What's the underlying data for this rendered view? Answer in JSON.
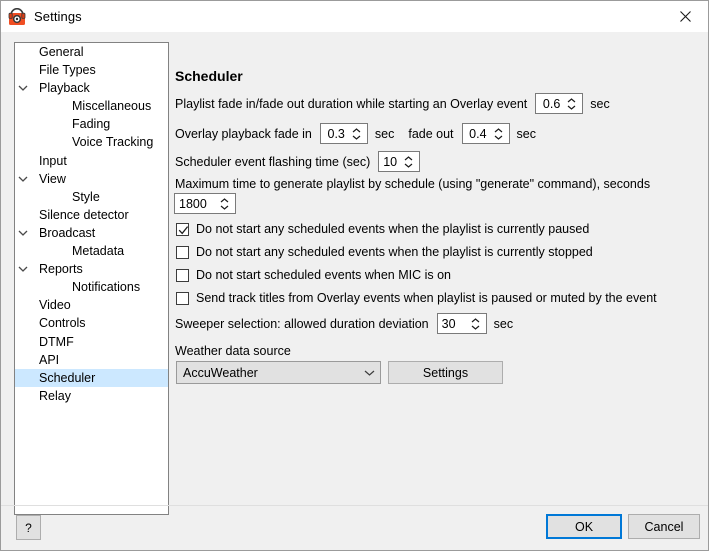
{
  "window": {
    "title": "Settings",
    "icon": "radio-headphones-icon",
    "close_icon": "close-icon",
    "accent": "#0078d7",
    "selection_color": "#cce8ff"
  },
  "sidebar": {
    "items": [
      {
        "label": "General",
        "level": 0,
        "expander": "",
        "selected": false
      },
      {
        "label": "File Types",
        "level": 0,
        "expander": "",
        "selected": false
      },
      {
        "label": "Playback",
        "level": 0,
        "expander": "chevron-down-icon",
        "selected": false
      },
      {
        "label": "Miscellaneous",
        "level": 1,
        "expander": "",
        "selected": false
      },
      {
        "label": "Fading",
        "level": 1,
        "expander": "",
        "selected": false
      },
      {
        "label": "Voice Tracking",
        "level": 1,
        "expander": "",
        "selected": false
      },
      {
        "label": "Input",
        "level": 0,
        "expander": "",
        "selected": false
      },
      {
        "label": "View",
        "level": 0,
        "expander": "chevron-down-icon",
        "selected": false
      },
      {
        "label": "Style",
        "level": 1,
        "expander": "",
        "selected": false
      },
      {
        "label": "Silence detector",
        "level": 0,
        "expander": "",
        "selected": false
      },
      {
        "label": "Broadcast",
        "level": 0,
        "expander": "chevron-down-icon",
        "selected": false
      },
      {
        "label": "Metadata",
        "level": 1,
        "expander": "",
        "selected": false
      },
      {
        "label": "Reports",
        "level": 0,
        "expander": "chevron-down-icon",
        "selected": false
      },
      {
        "label": "Notifications",
        "level": 1,
        "expander": "",
        "selected": false
      },
      {
        "label": "Video",
        "level": 0,
        "expander": "",
        "selected": false
      },
      {
        "label": "Controls",
        "level": 0,
        "expander": "",
        "selected": false
      },
      {
        "label": "DTMF",
        "level": 0,
        "expander": "",
        "selected": false
      },
      {
        "label": "API",
        "level": 0,
        "expander": "",
        "selected": false
      },
      {
        "label": "Scheduler",
        "level": 0,
        "expander": "",
        "selected": true
      },
      {
        "label": "Relay",
        "level": 0,
        "expander": "",
        "selected": false
      }
    ]
  },
  "panel": {
    "title": "Scheduler",
    "overlay_fade": {
      "label": "Playlist fade in/fade out duration while starting an Overlay event",
      "value": "0.6",
      "unit": "sec"
    },
    "playback_fade": {
      "label_in": "Overlay playback fade in",
      "value_in": "0.3",
      "unit_in": "sec",
      "label_out": "fade out",
      "value_out": "0.4",
      "unit_out": "sec"
    },
    "flashing_time": {
      "label": "Scheduler event flashing time (sec)",
      "value": "10"
    },
    "max_generate_time": {
      "label": "Maximum time to generate playlist by schedule (using \"generate\" command), seconds",
      "value": "1800"
    },
    "checkboxes": [
      {
        "label": "Do not start any scheduled events when the playlist is currently paused",
        "checked": true
      },
      {
        "label": "Do not start any scheduled events when the playlist is currently stopped",
        "checked": false
      },
      {
        "label": "Do not start scheduled events when MIC is on",
        "checked": false
      },
      {
        "label": "Send track titles from Overlay events when playlist is paused or muted by the event",
        "checked": false
      }
    ],
    "sweeper": {
      "label": "Sweeper selection: allowed duration deviation",
      "value": "30",
      "unit": "sec"
    },
    "weather": {
      "label": "Weather data source",
      "selected": "AccuWeather",
      "settings_button": "Settings",
      "dropdown_icon": "chevron-down-icon"
    }
  },
  "footer": {
    "help": "?",
    "ok": "OK",
    "cancel": "Cancel"
  }
}
